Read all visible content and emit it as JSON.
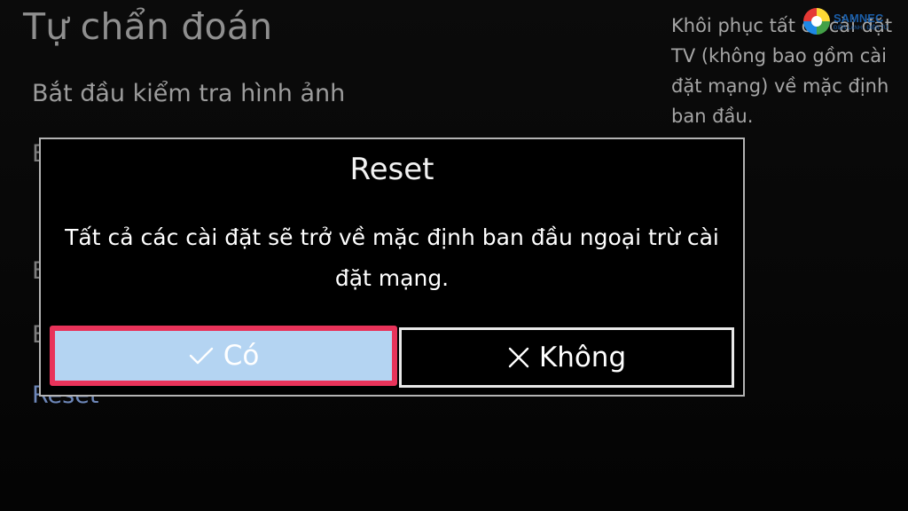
{
  "page": {
    "title": "Tự chẩn đoán"
  },
  "menu": {
    "items": [
      {
        "label": "Bắt đầu kiểm tra hình ảnh"
      },
      {
        "label": "B"
      },
      {
        "label": "B"
      },
      {
        "label": "B"
      },
      {
        "label": "Reset"
      }
    ]
  },
  "help_text": "Khôi phục tất cả cài đặt TV (không bao gồm cài đặt mạng) về mặc định ban đầu.",
  "logo": {
    "text": "SAMNEC",
    "tagline": "ĐIỆN LẠNH - ĐIỆN TỬ"
  },
  "dialog": {
    "title": "Reset",
    "message": "Tất cả các cài đặt sẽ trở về mặc định ban đầu ngoại trừ cài đặt mạng.",
    "buttons": {
      "yes": {
        "label": "Có",
        "icon": "checkmark-icon",
        "focused": true
      },
      "no": {
        "label": "Không",
        "icon": "close-icon"
      }
    }
  },
  "colors": {
    "focus_border": "#e8335a",
    "focus_fill": "#b4d4f2",
    "menu_selected": "#6d87b9"
  }
}
